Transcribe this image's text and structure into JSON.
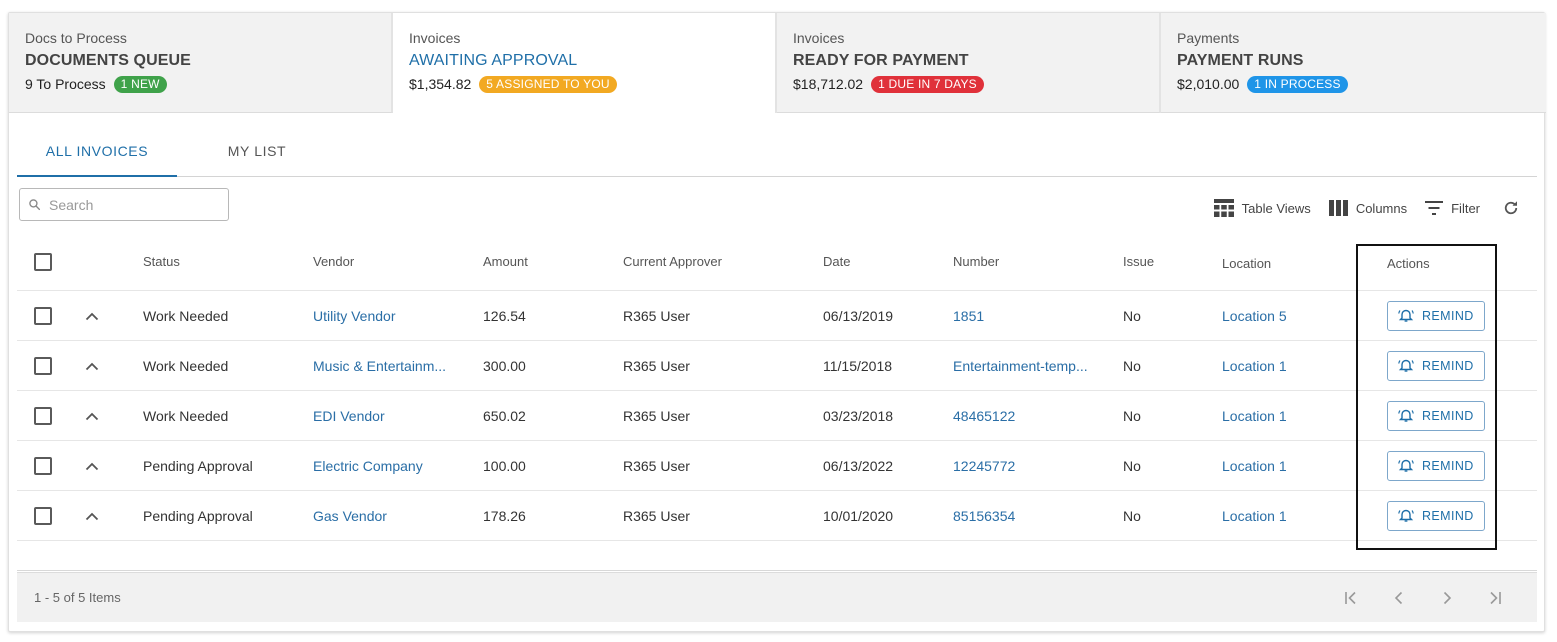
{
  "summary_cards": [
    {
      "category": "Docs to Process",
      "title": "DOCUMENTS QUEUE",
      "amount": "9 To Process",
      "badge": "1 NEW",
      "badge_color": "#3fa24a",
      "active": false
    },
    {
      "category": "Invoices",
      "title": "AWAITING APPROVAL",
      "amount": "$1,354.82",
      "badge": "5 ASSIGNED TO YOU",
      "badge_color": "#f2a922",
      "active": true
    },
    {
      "category": "Invoices",
      "title": "READY FOR PAYMENT",
      "amount": "$18,712.02",
      "badge": "1 DUE IN 7 DAYS",
      "badge_color": "#e0313a",
      "active": false
    },
    {
      "category": "Payments",
      "title": "PAYMENT RUNS",
      "amount": "$2,010.00",
      "badge": "1 IN PROCESS",
      "badge_color": "#1f95e8",
      "active": false
    }
  ],
  "tabs": [
    {
      "label": "ALL INVOICES",
      "active": true
    },
    {
      "label": "MY LIST",
      "active": false
    }
  ],
  "search": {
    "placeholder": "Search",
    "value": ""
  },
  "toolbar": {
    "table_views_label": "Table Views",
    "columns_label": "Columns",
    "filter_label": "Filter",
    "refresh_icon": "refresh-icon"
  },
  "table": {
    "headers": {
      "status": "Status",
      "vendor": "Vendor",
      "amount": "Amount",
      "approver": "Current Approver",
      "date": "Date",
      "number": "Number",
      "issue": "Issue",
      "location": "Location",
      "actions": "Actions"
    },
    "rows": [
      {
        "status": "Work Needed",
        "vendor": "Utility Vendor",
        "amount": "126.54",
        "approver": "R365 User",
        "date": "06/13/2019",
        "number": "1851",
        "issue": "No",
        "location": "Location 5",
        "action": "REMIND"
      },
      {
        "status": "Work Needed",
        "vendor": "Music & Entertainm...",
        "amount": "300.00",
        "approver": "R365 User",
        "date": "11/15/2018",
        "number": "Entertainment-temp...",
        "issue": "No",
        "location": "Location 1",
        "action": "REMIND"
      },
      {
        "status": "Work Needed",
        "vendor": "EDI Vendor",
        "amount": "650.02",
        "approver": "R365 User",
        "date": "03/23/2018",
        "number": "48465122",
        "issue": "No",
        "location": "Location 1",
        "action": "REMIND"
      },
      {
        "status": "Pending Approval",
        "vendor": "Electric Company",
        "amount": "100.00",
        "approver": "R365 User",
        "date": "06/13/2022",
        "number": "12245772",
        "issue": "No",
        "location": "Location 1",
        "action": "REMIND"
      },
      {
        "status": "Pending Approval",
        "vendor": "Gas Vendor",
        "amount": "178.26",
        "approver": "R365 User",
        "date": "10/01/2020",
        "number": "85156354",
        "issue": "No",
        "location": "Location 1",
        "action": "REMIND"
      }
    ]
  },
  "pagination": {
    "summary": "1 - 5 of 5 Items"
  },
  "colors": {
    "accent": "#1f6fa8",
    "link": "#2a6ea6"
  }
}
